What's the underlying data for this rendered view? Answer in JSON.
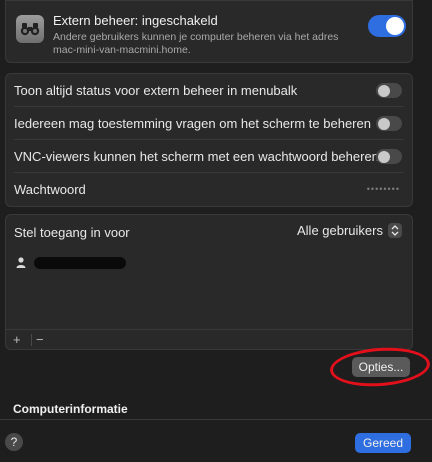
{
  "header": {
    "title": "Extern beheer: ingeschakeld",
    "subtitle": "Andere gebruikers kunnen je computer beheren via het adres mac-mini-van-macmini.home.",
    "toggle_on": true,
    "icon": "binoculars-icon"
  },
  "settings": {
    "rows": [
      {
        "label": "Toon altijd status voor extern beheer in menubalk",
        "toggle_on": false
      },
      {
        "label": "Iedereen mag toestemming vragen om het scherm te beheren",
        "toggle_on": false
      },
      {
        "label": "VNC-viewers kunnen het scherm met een wachtwoord beheren",
        "toggle_on": false
      },
      {
        "label": "Wachtwoord",
        "value": "••••••••"
      }
    ]
  },
  "access": {
    "title": "Stel toegang in voor",
    "select_value": "Alle gebruikers",
    "user_icon": "person-icon",
    "add_label": "+",
    "remove_label": "−"
  },
  "buttons": {
    "options": "Opties...",
    "done": "Gereed",
    "help": "?"
  },
  "sections": {
    "computer_info": "Computerinformatie"
  },
  "colors": {
    "accent": "#2f6ee0",
    "annotation": "#e3101c",
    "background": "#1f1e1e",
    "panel": "#2a2929"
  }
}
